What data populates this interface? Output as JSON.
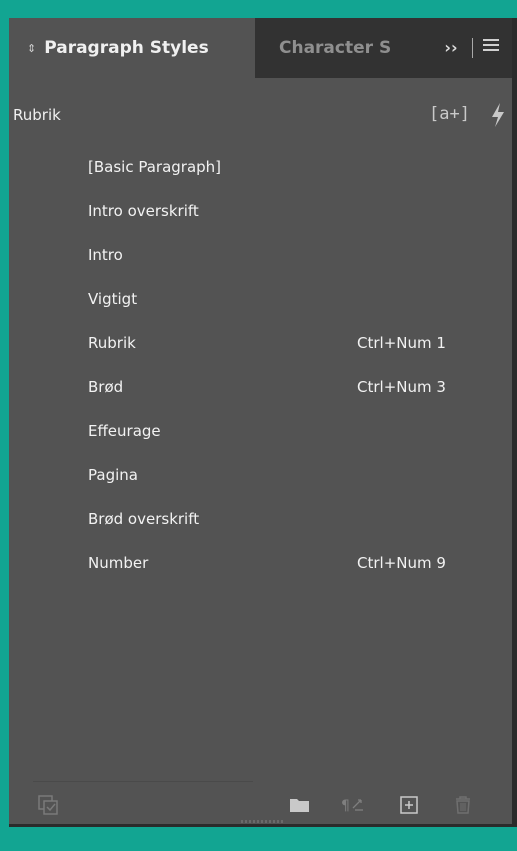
{
  "tabs": {
    "active_label": "Paragraph Styles",
    "inactive_label": "Character S",
    "overflow_label": "››"
  },
  "current_style": "Rubrik",
  "header_buttons": {
    "new_style_label": "[a+]"
  },
  "styles": [
    {
      "name": "[Basic Paragraph]",
      "shortcut": ""
    },
    {
      "name": "Intro overskrift",
      "shortcut": ""
    },
    {
      "name": "Intro",
      "shortcut": ""
    },
    {
      "name": "Vigtigt",
      "shortcut": ""
    },
    {
      "name": "Rubrik",
      "shortcut": "Ctrl+Num 1"
    },
    {
      "name": "Brød",
      "shortcut": "Ctrl+Num 3"
    },
    {
      "name": "Effeurage",
      "shortcut": ""
    },
    {
      "name": "Pagina",
      "shortcut": ""
    },
    {
      "name": "Brød overskrift",
      "shortcut": ""
    },
    {
      "name": "Number",
      "shortcut": "Ctrl+Num 9"
    }
  ],
  "icons": {
    "tab_toggle": "updown-arrows-icon",
    "panel_menu": "hamburger-menu-icon",
    "bolt": "lightning-bolt-icon",
    "load_styles": "load-styles-icon",
    "folder": "folder-icon",
    "clear_overrides": "clear-overrides-icon",
    "new": "plus-square-icon",
    "delete": "trash-icon"
  },
  "colors": {
    "panel_bg": "#535353",
    "tab_bar_bg": "#323232",
    "frame_accent": "#12a592",
    "text": "#f0f0f0"
  }
}
